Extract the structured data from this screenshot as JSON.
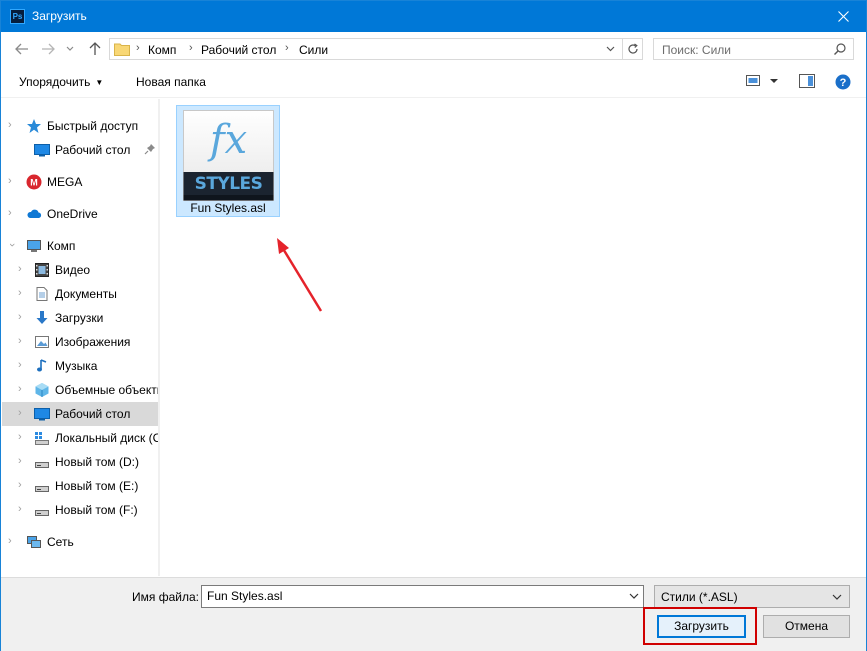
{
  "window": {
    "title": "Загрузить",
    "app_icon_text": "Ps"
  },
  "address": {
    "crumbs": [
      "Комп",
      "Рабочий стол",
      "Сили"
    ],
    "search_placeholder": "Поиск: Сили"
  },
  "toolbar": {
    "organize_label": "Упорядочить",
    "new_folder_label": "Новая папка"
  },
  "nav": {
    "items": [
      {
        "label": "Быстрый доступ",
        "icon": "star-icon"
      },
      {
        "label": "Рабочий стол",
        "icon": "desktop-icon"
      },
      {
        "label": "MEGA",
        "icon": "mega-icon"
      },
      {
        "label": "OneDrive",
        "icon": "cloud-icon"
      },
      {
        "label": "Комп",
        "icon": "computer-icon"
      },
      {
        "label": "Видео",
        "icon": "video-icon"
      },
      {
        "label": "Документы",
        "icon": "documents-icon"
      },
      {
        "label": "Загрузки",
        "icon": "downloads-icon"
      },
      {
        "label": "Изображения",
        "icon": "pictures-icon"
      },
      {
        "label": "Музыка",
        "icon": "music-icon"
      },
      {
        "label": "Объемные объекты",
        "icon": "3d-objects-icon"
      },
      {
        "label": "Рабочий стол",
        "icon": "desktop-icon"
      },
      {
        "label": "Локальный диск (C:)",
        "icon": "system-drive-icon"
      },
      {
        "label": "Новый том (D:)",
        "icon": "drive-icon"
      },
      {
        "label": "Новый том (E:)",
        "icon": "drive-icon"
      },
      {
        "label": "Новый том (F:)",
        "icon": "drive-icon"
      },
      {
        "label": "Сеть",
        "icon": "network-icon"
      }
    ]
  },
  "content": {
    "file": {
      "name": "Fun Styles.asl",
      "thumb_top": "fx",
      "thumb_bottom": "STYLES"
    }
  },
  "bottom": {
    "filename_label": "Имя файла:",
    "filename_value": "Fun Styles.asl",
    "filetype_value": "Стили (*.ASL)",
    "load_label": "Загрузить",
    "cancel_label": "Отмена"
  },
  "colors": {
    "titlebar": "#0078d7",
    "selection": "#cce8ff",
    "highlight_red": "#d00000"
  }
}
